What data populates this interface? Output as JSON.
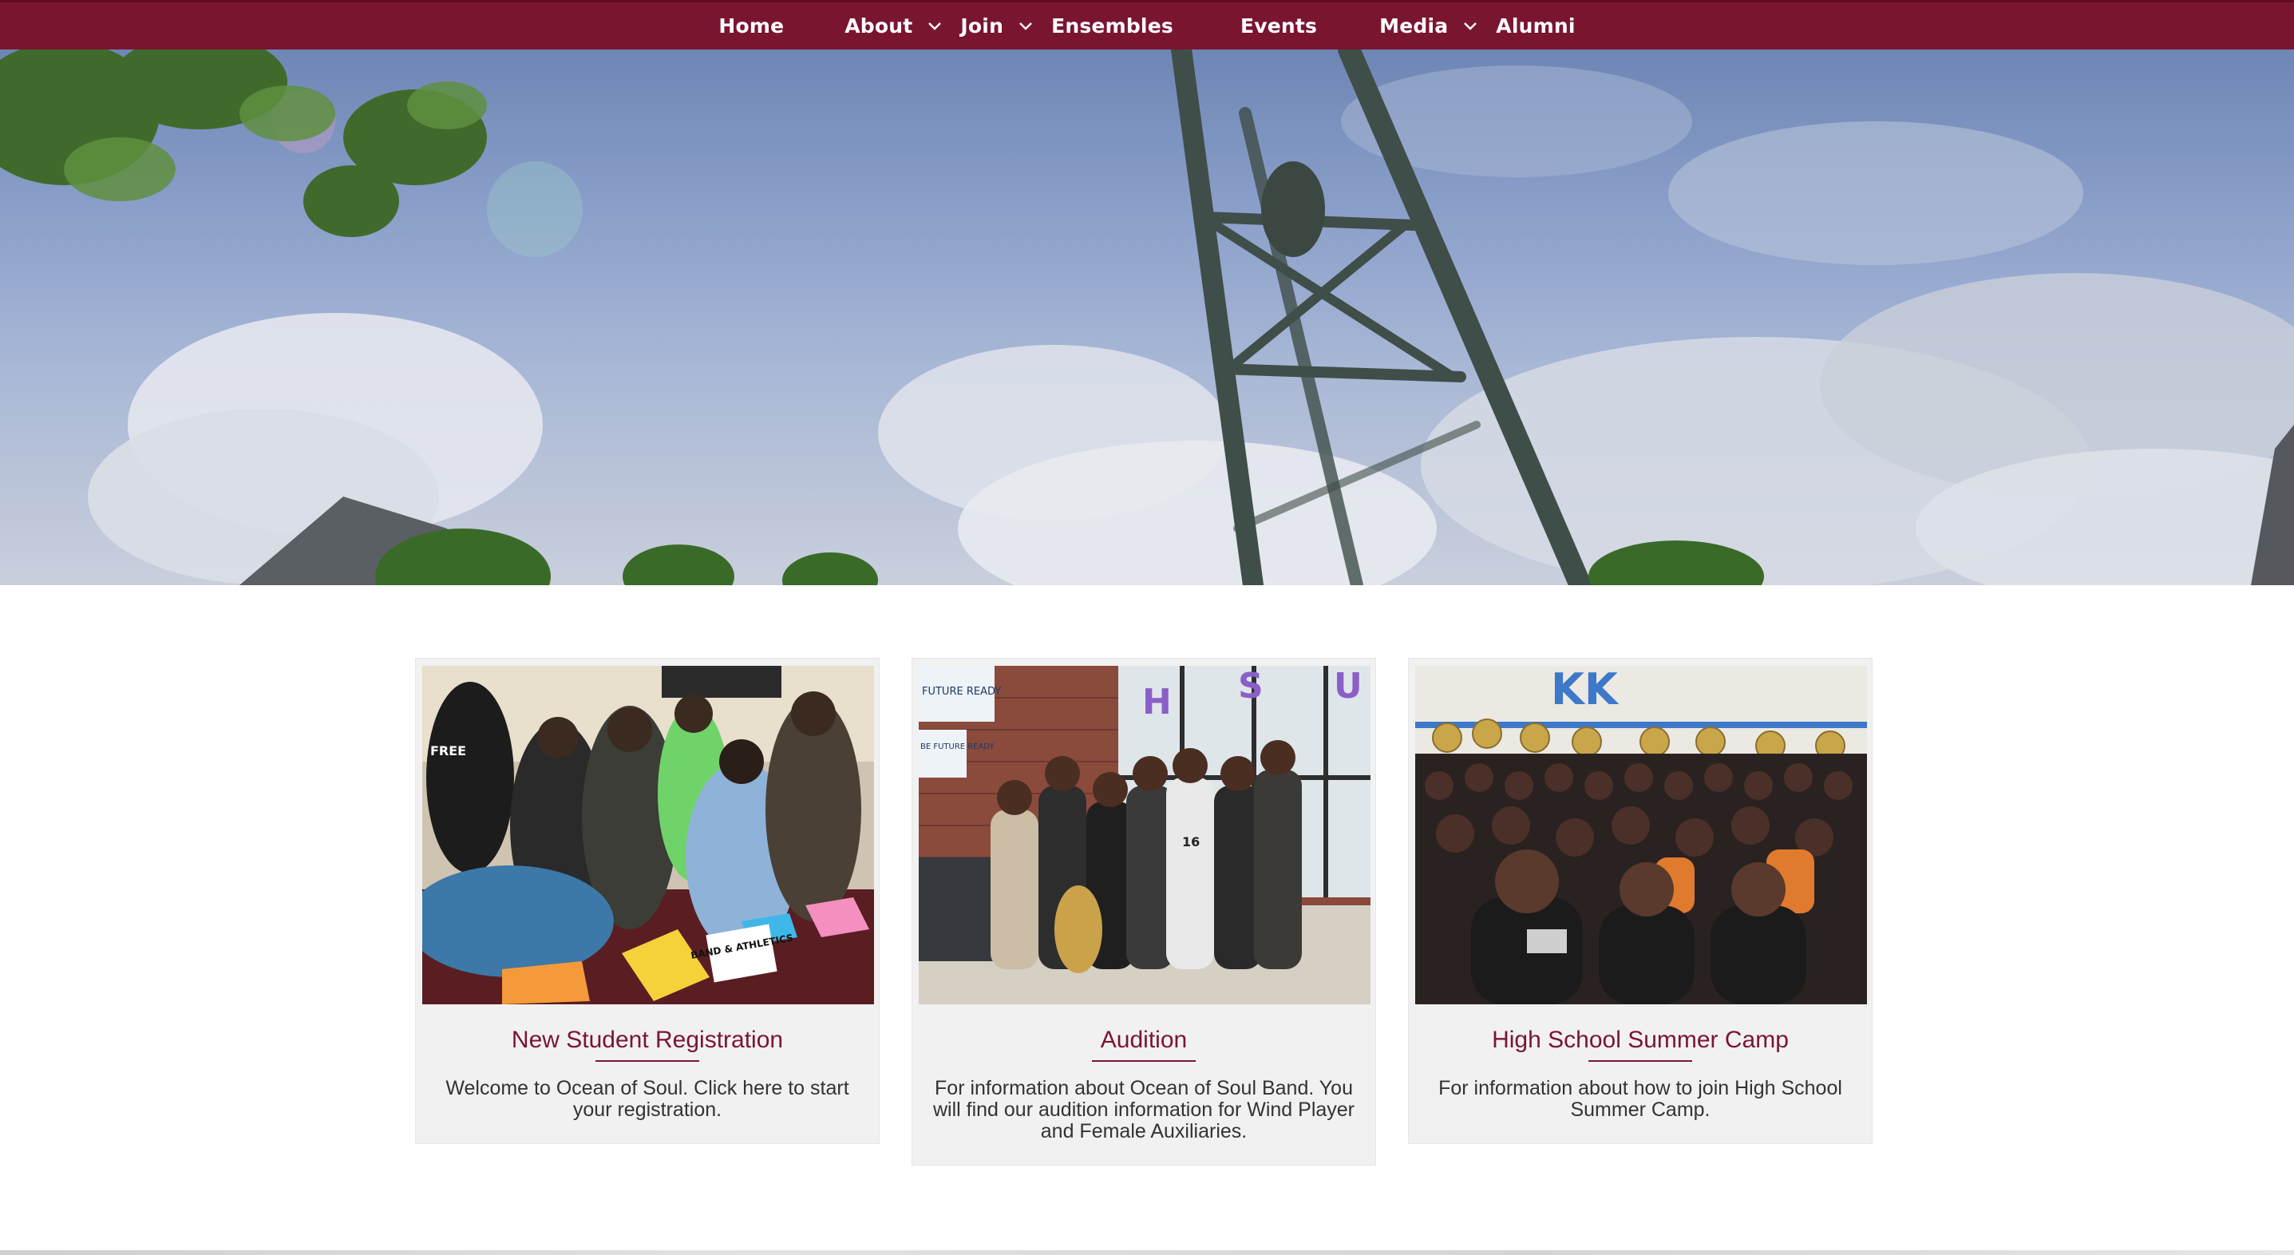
{
  "nav": {
    "items": [
      {
        "label": "Home",
        "has_dropdown": false
      },
      {
        "label": "About",
        "has_dropdown": true
      },
      {
        "label": "Join",
        "has_dropdown": true
      },
      {
        "label": "Ensembles",
        "has_dropdown": false
      },
      {
        "label": "Events",
        "has_dropdown": false
      },
      {
        "label": "Media",
        "has_dropdown": true
      },
      {
        "label": "Alumni",
        "has_dropdown": false
      }
    ]
  },
  "colors": {
    "brand_maroon": "#7a1530",
    "card_bg": "#f1f1f1",
    "text": "#333333"
  },
  "cards": [
    {
      "title": "New Student Registration",
      "description": "Welcome to Ocean of Soul. Click here to start your registration.",
      "image_signs": [
        "FREE",
        "BAND & ATHLETICS"
      ]
    },
    {
      "title": "Audition",
      "description": "For information about Ocean of Soul Band. You will find our audition information for Wind Player and Female Auxiliaries.",
      "image_signs": [
        "FUTURE READY",
        "BE FUTURE READY",
        "16"
      ]
    },
    {
      "title": "High School Summer Camp",
      "description": "For information about how to join High School Summer Camp.",
      "image_signs": [
        "KK"
      ]
    }
  ]
}
